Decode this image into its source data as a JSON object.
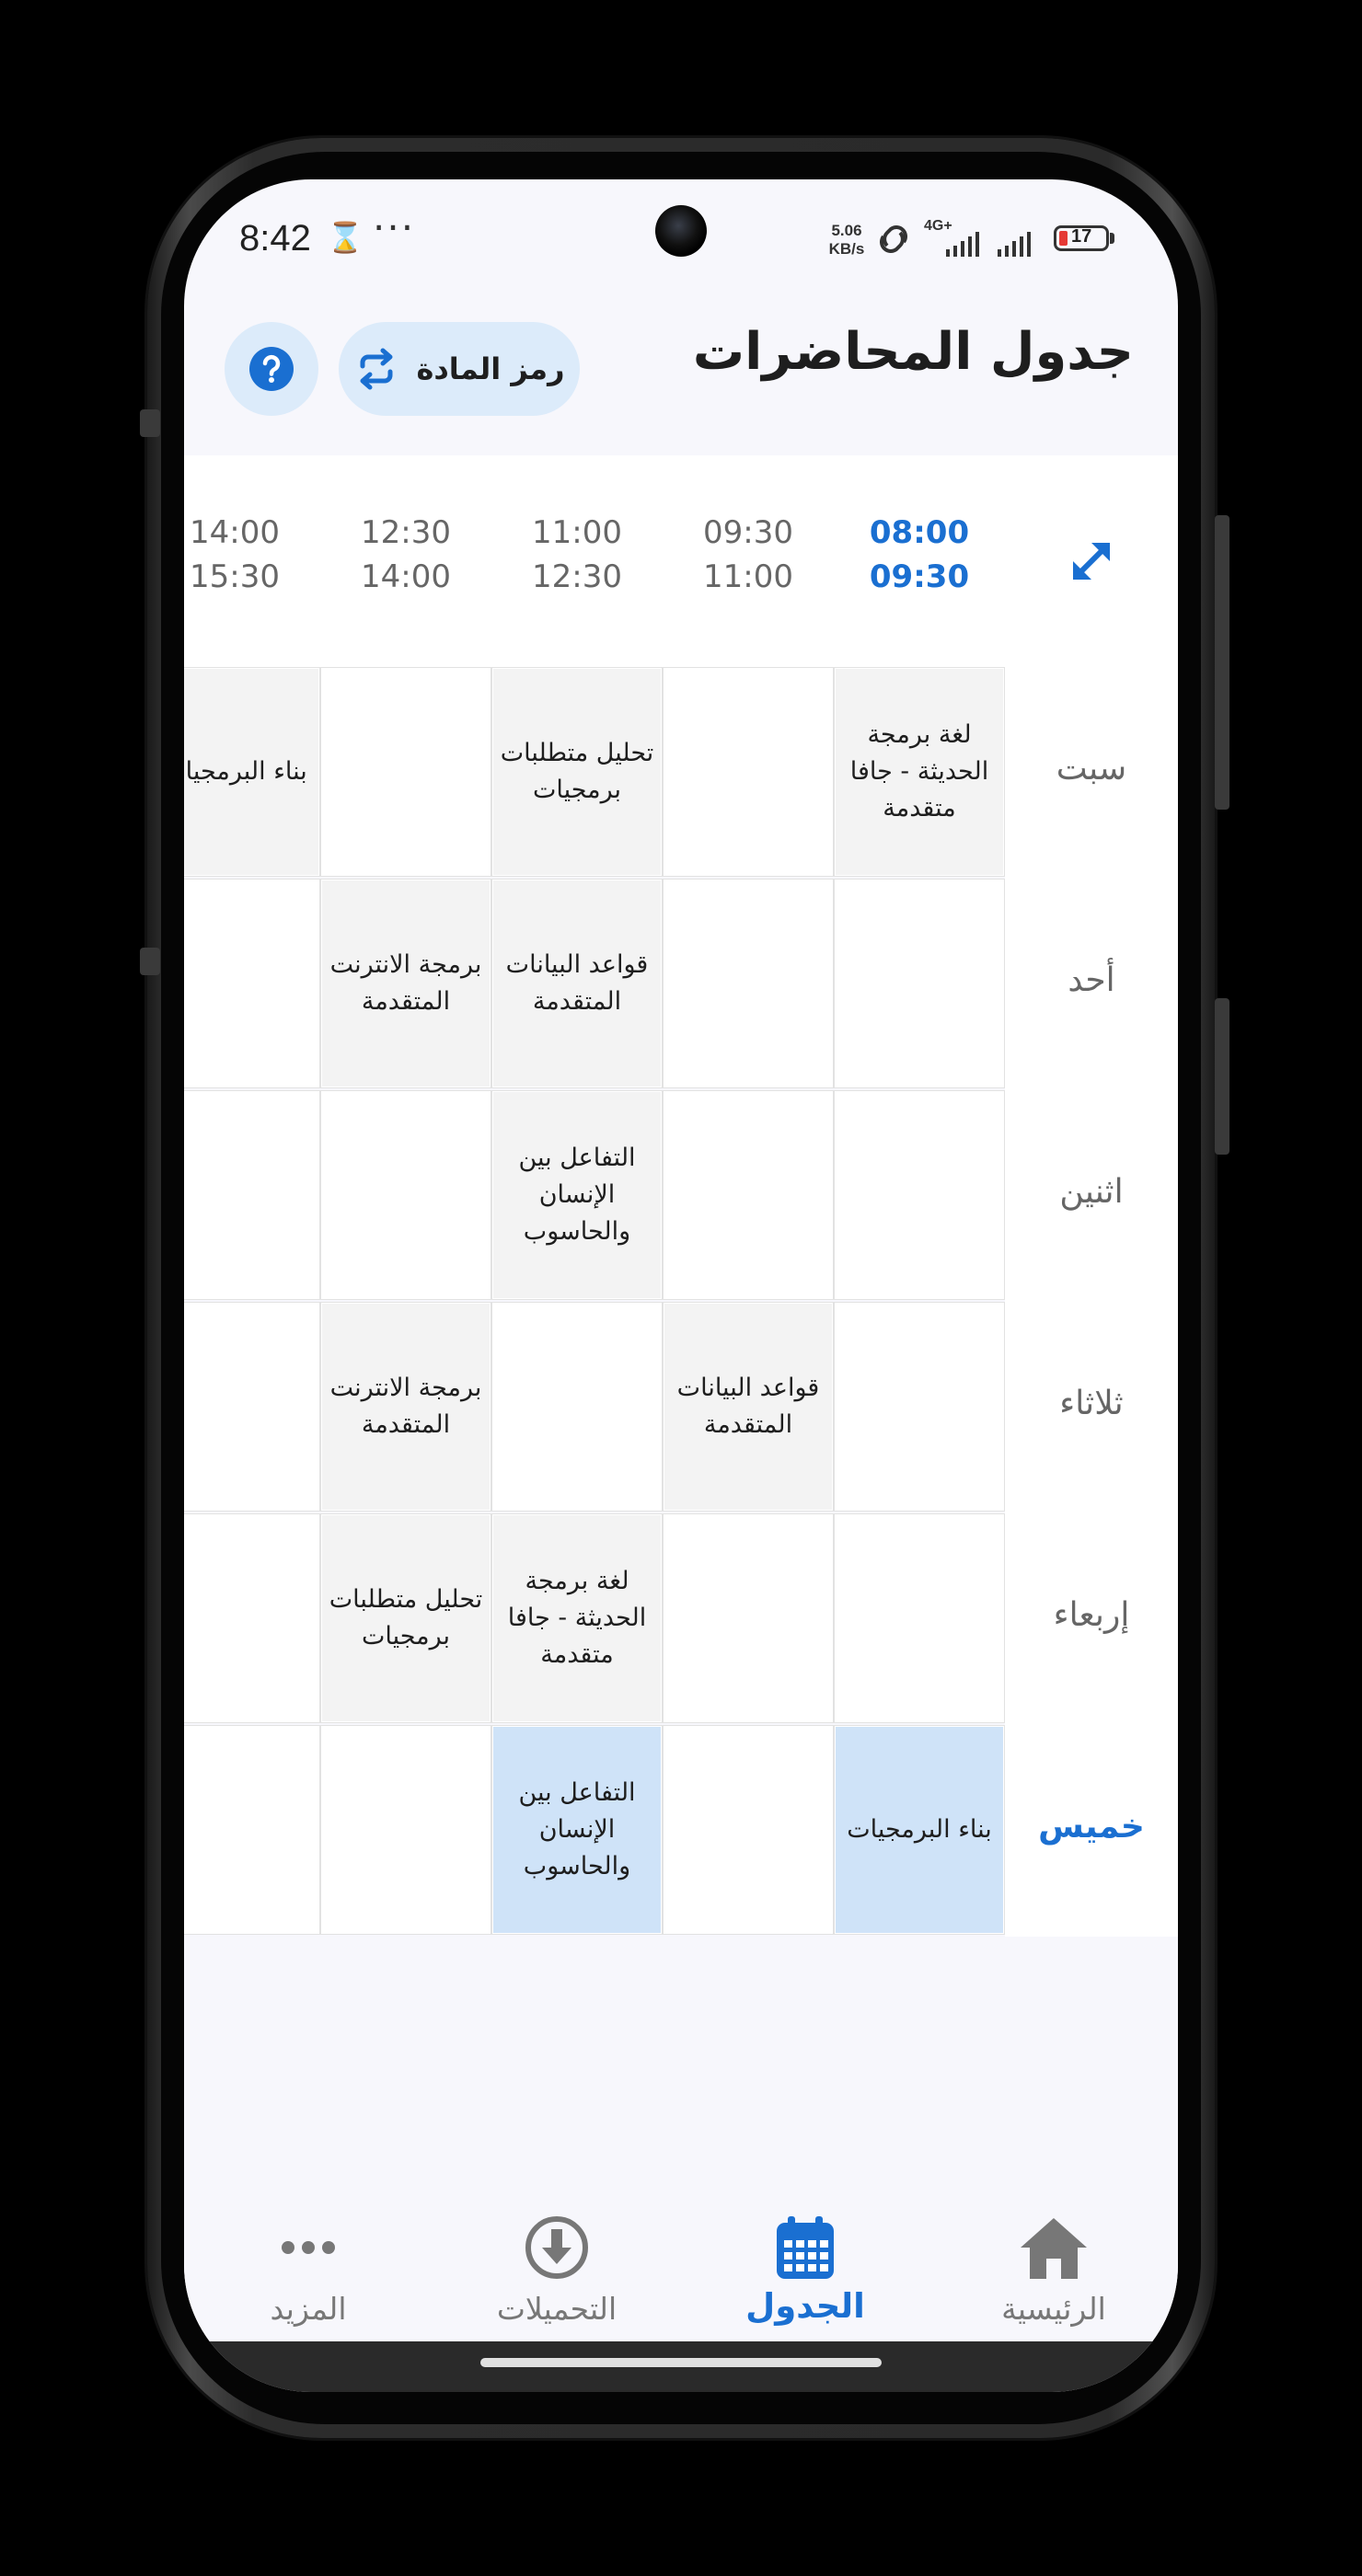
{
  "status_bar": {
    "time": "8:42",
    "dots": "···",
    "net_speed_value": "5.06",
    "net_speed_unit": "KB/s",
    "network_type": "4G+",
    "battery": "17"
  },
  "header": {
    "title": "جدول المحاضرات",
    "course_code_button": "رمز المادة",
    "help_icon": "question-icon",
    "swap_icon": "repeat-icon"
  },
  "timetable": {
    "expand_icon": "expand-arrows-icon",
    "slots": [
      {
        "start": "08:00",
        "end": "09:30",
        "active": true
      },
      {
        "start": "09:30",
        "end": "11:00",
        "active": false
      },
      {
        "start": "11:00",
        "end": "12:30",
        "active": false
      },
      {
        "start": "12:30",
        "end": "14:00",
        "active": false
      },
      {
        "start": "14:00",
        "end": "15:30",
        "active": false
      }
    ],
    "days": [
      {
        "name": "سبت",
        "active": false,
        "cells": [
          "لغة برمجة الحديثة - جافا متقدمة",
          "",
          "تحليل متطلبات برمجيات",
          "",
          "بناء البرمجيات"
        ]
      },
      {
        "name": "أحد",
        "active": false,
        "cells": [
          "",
          "",
          "قواعد البيانات المتقدمة",
          "برمجة الانترنت المتقدمة",
          ""
        ]
      },
      {
        "name": "اثنين",
        "active": false,
        "cells": [
          "",
          "",
          "التفاعل بين الإنسان والحاسوب",
          "",
          ""
        ]
      },
      {
        "name": "ثلاثاء",
        "active": false,
        "cells": [
          "",
          "قواعد البيانات المتقدمة",
          "",
          "برمجة الانترنت المتقدمة",
          ""
        ]
      },
      {
        "name": "إربعاء",
        "active": false,
        "cells": [
          "",
          "",
          "لغة برمجة الحديثة - جافا متقدمة",
          "تحليل متطلبات برمجيات",
          ""
        ]
      },
      {
        "name": "خميس",
        "active": true,
        "cells": [
          "بناء البرمجيات",
          "",
          "التفاعل بين الإنسان والحاسوب",
          "",
          ""
        ]
      }
    ]
  },
  "bottom_nav": {
    "items": [
      {
        "label": "الرئيسية",
        "icon": "home-icon",
        "active": false
      },
      {
        "label": "الجدول",
        "icon": "calendar-icon",
        "active": true
      },
      {
        "label": "التحميلات",
        "icon": "download-icon",
        "active": false
      },
      {
        "label": "المزيد",
        "icon": "more-icon",
        "active": false
      }
    ]
  },
  "colors": {
    "accent": "#1a6fd1",
    "accent_light": "#dcebfa",
    "today_cell": "#cfe3f8",
    "course_cell": "#f3f3f3"
  }
}
